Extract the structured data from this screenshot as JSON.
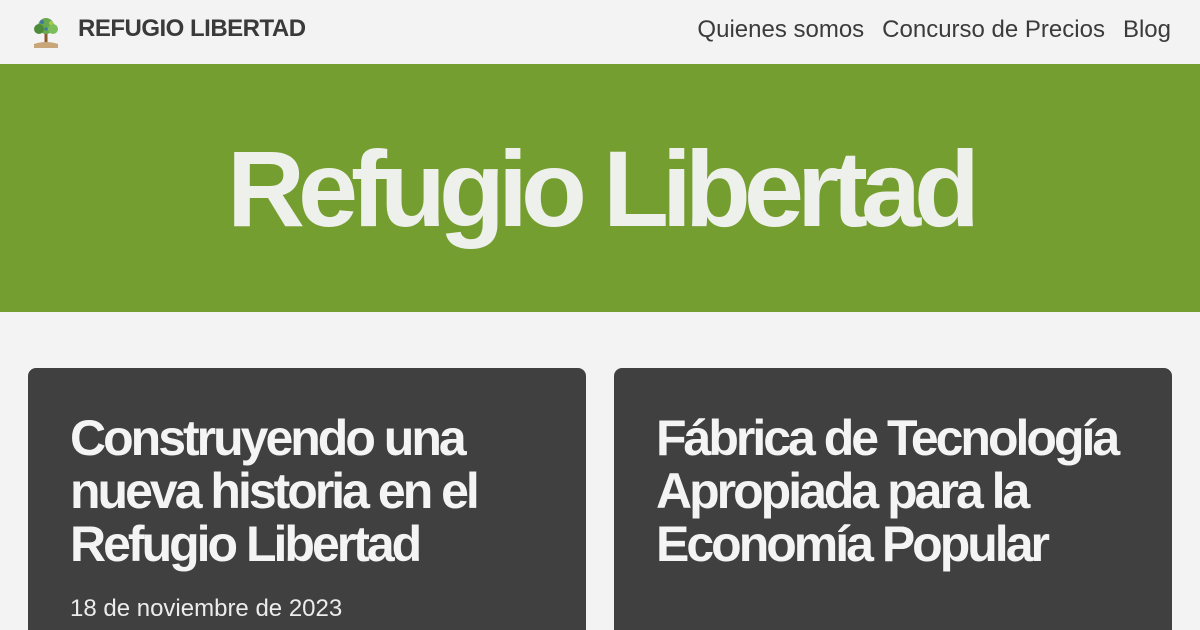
{
  "header": {
    "brand": "REFUGIO LIBERTAD",
    "nav": [
      "Quienes somos",
      "Concurso de Precios",
      "Blog"
    ]
  },
  "hero": {
    "title": "Refugio Libertad"
  },
  "posts": [
    {
      "title": "Construyendo una nueva historia en el Refugio Libertad",
      "date": "18 de noviembre de 2023"
    },
    {
      "title": "Fábrica de Tecnología Apropiada para la Economía Popular"
    }
  ],
  "colors": {
    "hero_bg": "#759e30",
    "card_bg": "#404040",
    "page_bg": "#f3f3f3"
  },
  "icons": {
    "logo": "tree-logo-icon"
  }
}
